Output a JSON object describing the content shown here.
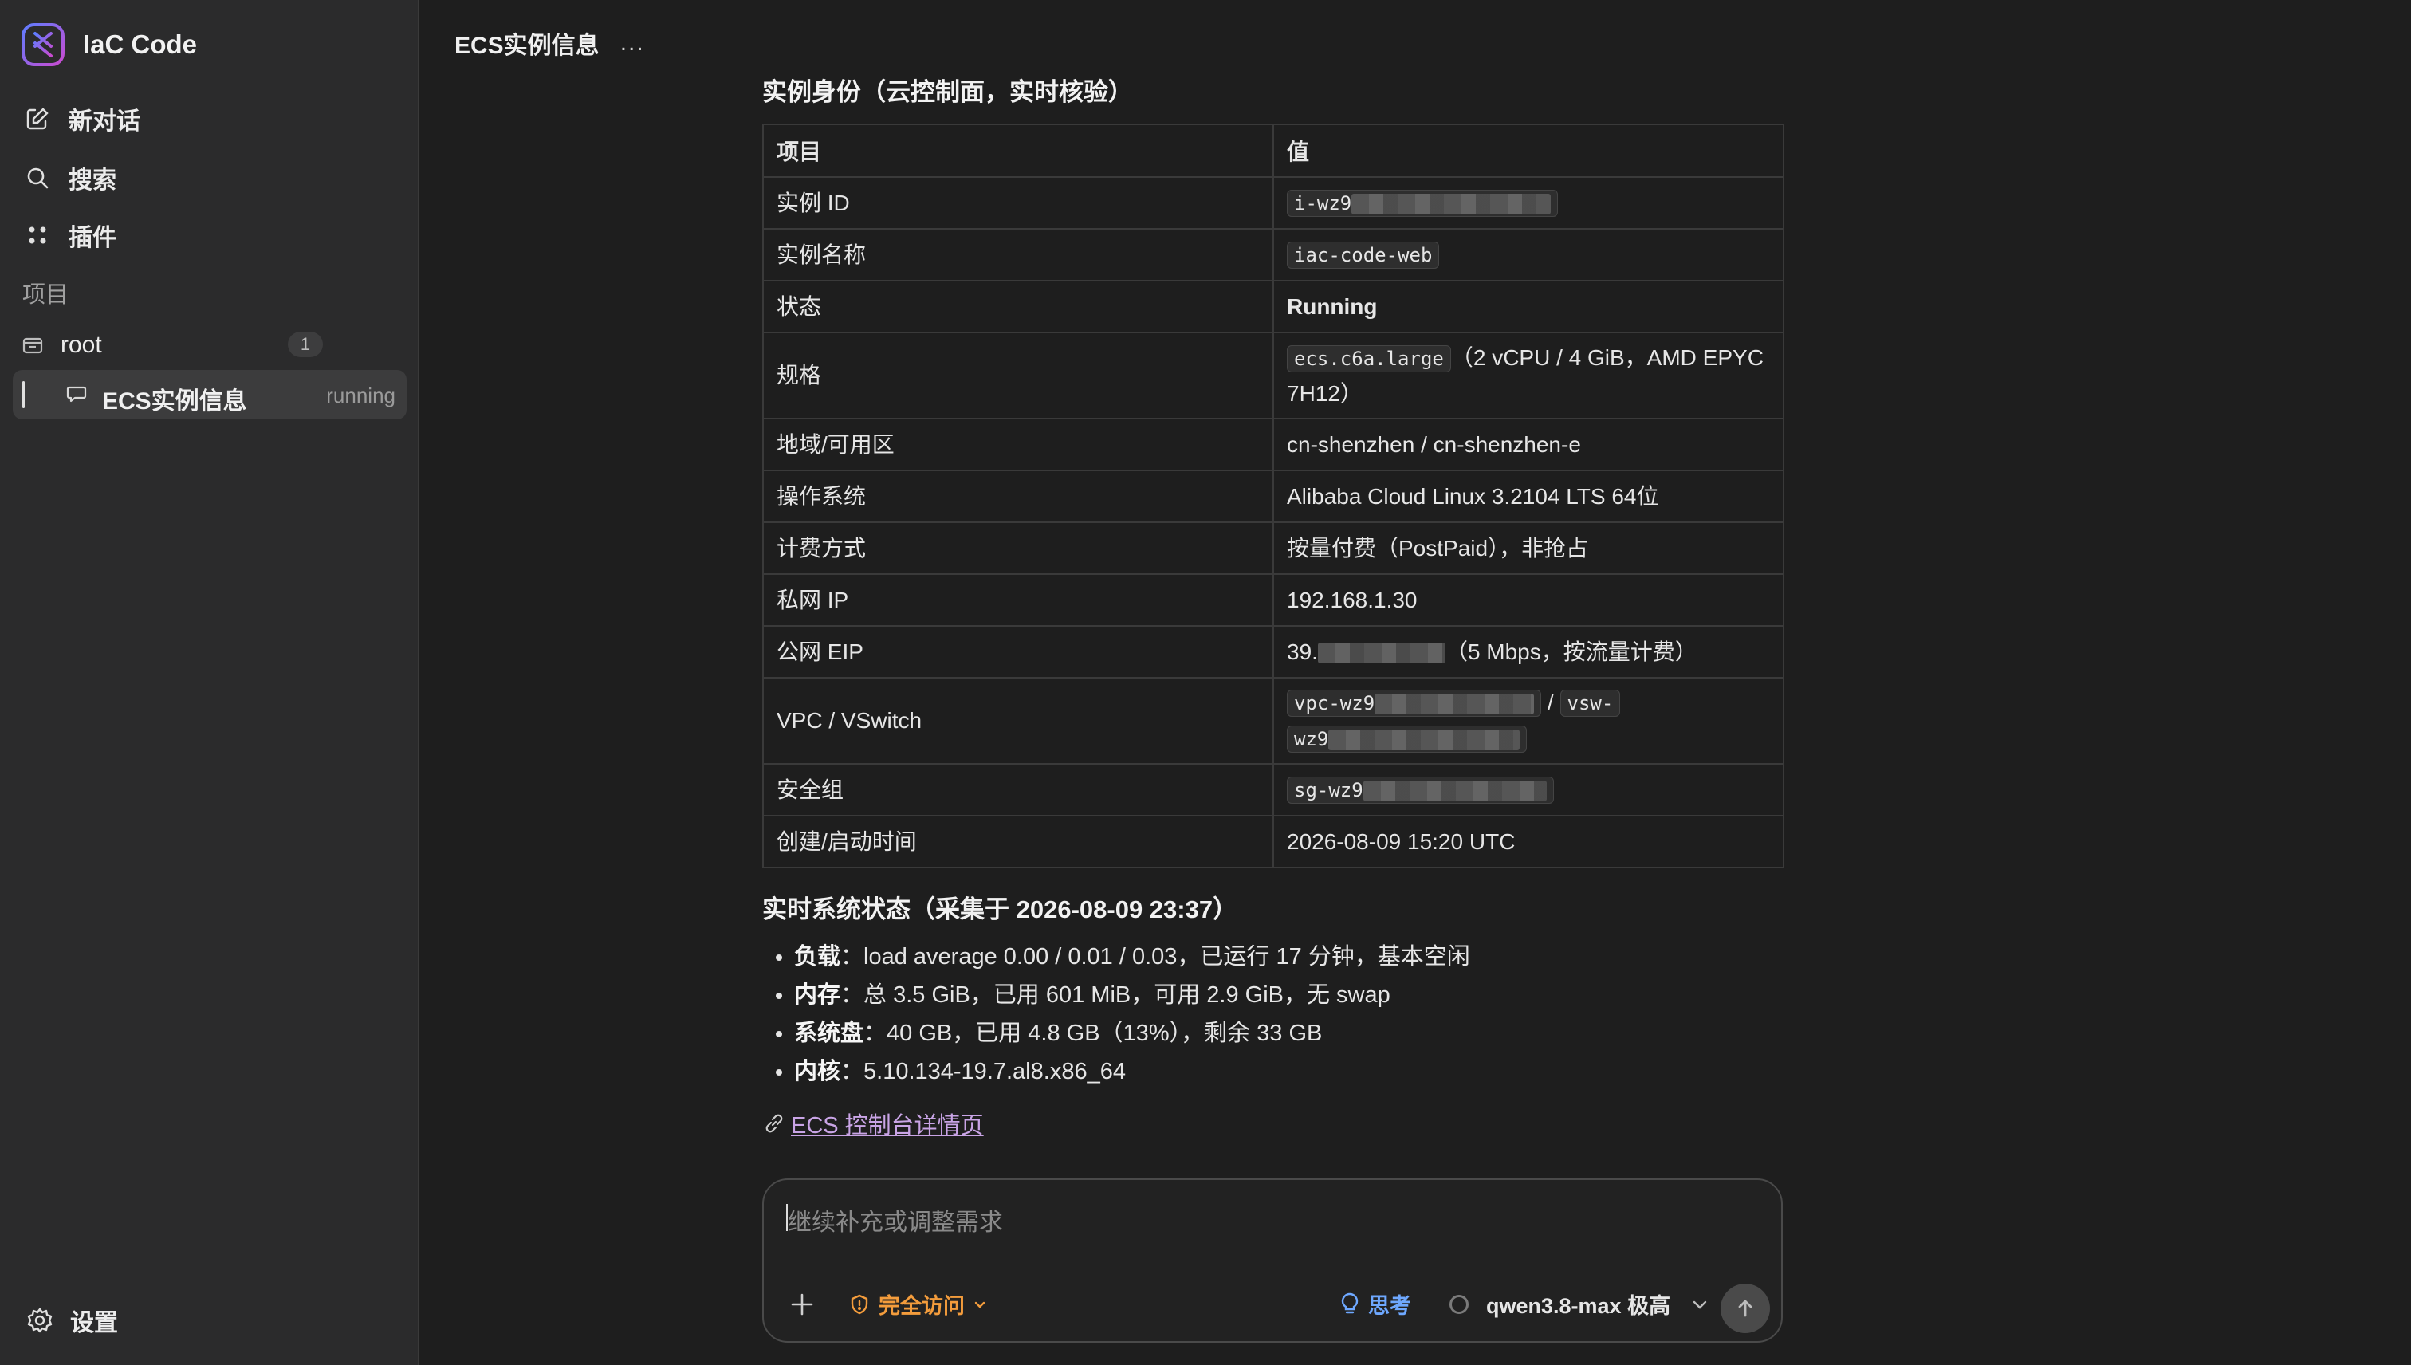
{
  "brand": {
    "name": "IaC Code"
  },
  "nav": {
    "new_chat": "新对话",
    "search": "搜索",
    "plugins": "插件"
  },
  "projects": {
    "section_label": "项目",
    "items": [
      {
        "label": "root",
        "badge": "1"
      }
    ]
  },
  "sessions": [
    {
      "label": "ECS实例信息",
      "status": "running"
    }
  ],
  "settings": {
    "label": "设置"
  },
  "header": {
    "title": "ECS实例信息",
    "more": "..."
  },
  "instance": {
    "heading": "实例身份（云控制面，实时核验）",
    "columns": [
      "项目",
      "值"
    ],
    "rows": [
      {
        "label": "实例 ID",
        "value_prefix": "i-wz9"
      },
      {
        "label": "实例名称",
        "value": "iac-code-web"
      },
      {
        "label": "状态",
        "value": "Running"
      },
      {
        "label": "规格",
        "code": "ecs.c6a.large",
        "value": "（2 vCPU / 4 GiB，AMD EPYC 7H12）"
      },
      {
        "label": "地域/可用区",
        "value": "cn-shenzhen / cn-shenzhen-e"
      },
      {
        "label": "操作系统",
        "value": "Alibaba Cloud Linux 3.2104 LTS 64位"
      },
      {
        "label": "计费方式",
        "value": "按量付费（PostPaid），非抢占"
      },
      {
        "label": "私网 IP",
        "value": "192.168.1.30"
      },
      {
        "label": "公网 EIP",
        "value_prefix": "39.",
        "value_suffix": "（5 Mbps，按流量计费）"
      },
      {
        "label": "VPC / VSwitch",
        "vpc_prefix": "vpc-wz9",
        "sep": "/",
        "vsw_prefix": "vsw-",
        "vsw_line2": "wz9"
      },
      {
        "label": "安全组",
        "value_prefix": "sg-wz9"
      },
      {
        "label": "创建/启动时间",
        "value": "2026-08-09 15:20 UTC"
      }
    ]
  },
  "system": {
    "heading": "实时系统状态（采集于 2026-08-09 23:37）",
    "items": [
      {
        "key": "负载",
        "text": "：load average 0.00 / 0.01 / 0.03，已运行 17 分钟，基本空闲"
      },
      {
        "key": "内存",
        "text": "：总 3.5 GiB，已用 601 MiB，可用 2.9 GiB，无 swap"
      },
      {
        "key": "系统盘",
        "text": "：40 GB，已用 4.8 GB（13%），剩余 33 GB"
      },
      {
        "key": "内核",
        "text": "：5.10.134-19.7.al8.x86_64"
      }
    ],
    "console_link": "ECS 控制台详情页"
  },
  "composer": {
    "placeholder": "继续补充或调整需求",
    "access_label": "完全访问",
    "think_label": "思考",
    "model_label": "qwen3.8-max 极高"
  },
  "colors": {
    "accent_orange": "#f39c3c",
    "accent_blue": "#6ea8ff",
    "link_purple": "#c9a4e6",
    "brand_gradient": [
      "#6a7bff",
      "#c14bd6"
    ]
  }
}
